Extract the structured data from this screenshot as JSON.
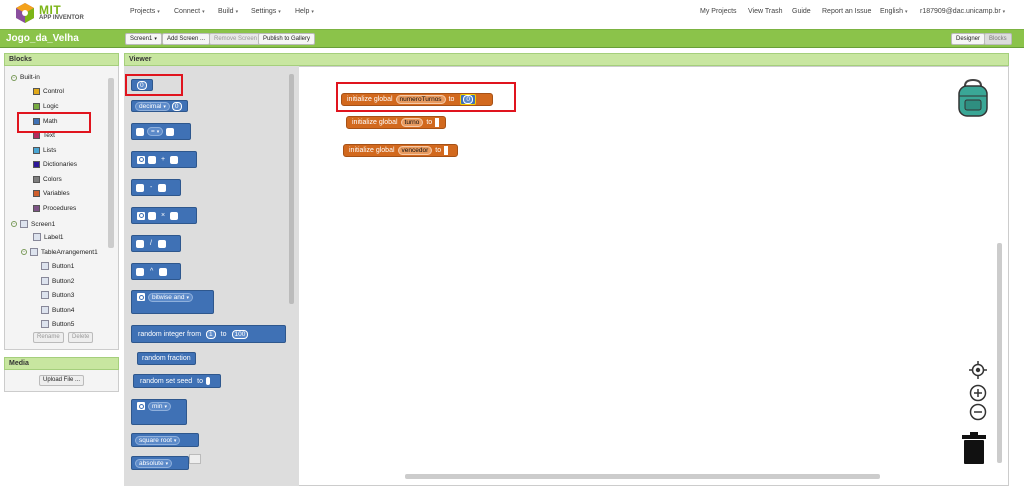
{
  "app": {
    "logo_main": "MIT",
    "logo_sub": "APP INVENTOR"
  },
  "topnav": {
    "left_menus": [
      "Projects",
      "Connect",
      "Build",
      "Settings",
      "Help"
    ],
    "right_links": [
      "My Projects",
      "View Trash",
      "Guide",
      "Report an Issue"
    ],
    "language": "English",
    "account": "r187909@dac.unicamp.br"
  },
  "toolbar": {
    "project_name": "Jogo_da_Velha",
    "screen_select": "Screen1",
    "add_screen": "Add Screen ...",
    "remove_screen": "Remove Screen",
    "publish": "Publish to Gallery",
    "designer": "Designer",
    "blocks": "Blocks"
  },
  "blocks_panel": {
    "title": "Blocks",
    "builtin_label": "Built-in",
    "builtin_items": [
      {
        "label": "Control",
        "color": "#e1a91a"
      },
      {
        "label": "Logic",
        "color": "#77ab41"
      },
      {
        "label": "Math",
        "color": "#3f71b5"
      },
      {
        "label": "Text",
        "color": "#b32d5e"
      },
      {
        "label": "Lists",
        "color": "#49a6d4"
      },
      {
        "label": "Dictionaries",
        "color": "#2d1799"
      },
      {
        "label": "Colors",
        "color": "#7d7d7d"
      },
      {
        "label": "Variables",
        "color": "#d05f2d"
      },
      {
        "label": "Procedures",
        "color": "#7c5385"
      }
    ],
    "screen_label": "Screen1",
    "components": [
      "Label1",
      "TableArrangement1"
    ],
    "buttons": [
      "Button1",
      "Button2",
      "Button3",
      "Button4",
      "Button5"
    ],
    "rename": "Rename",
    "delete": "Delete"
  },
  "media_panel": {
    "title": "Media",
    "upload": "Upload File ..."
  },
  "viewer": {
    "title": "Viewer"
  },
  "flyout": {
    "number_value": "0",
    "decimal_label": "decimal",
    "decimal_value": "0",
    "eq_op": "=",
    "plus_op": "+",
    "minus_op": "-",
    "times_op": "×",
    "div_op": "/",
    "pow_op": "^",
    "bitwise_label": "bitwise and",
    "random_int_label": "random integer from",
    "random_int_from": "1",
    "random_int_to_label": "to",
    "random_int_to": "100",
    "random_fraction": "random fraction",
    "random_seed_label": "random set seed",
    "random_seed_to": "to",
    "min_label": "min",
    "sqrt_label": "square root",
    "absolute_label": "absolute"
  },
  "workspace": {
    "var1": {
      "prefix": "initialize global",
      "name": "numeroTurnos",
      "to": "to",
      "value": "0"
    },
    "var2": {
      "prefix": "initialize global",
      "name": "turno",
      "to": "to"
    },
    "var3": {
      "prefix": "initialize global",
      "name": "vencedor",
      "to": "to"
    }
  }
}
